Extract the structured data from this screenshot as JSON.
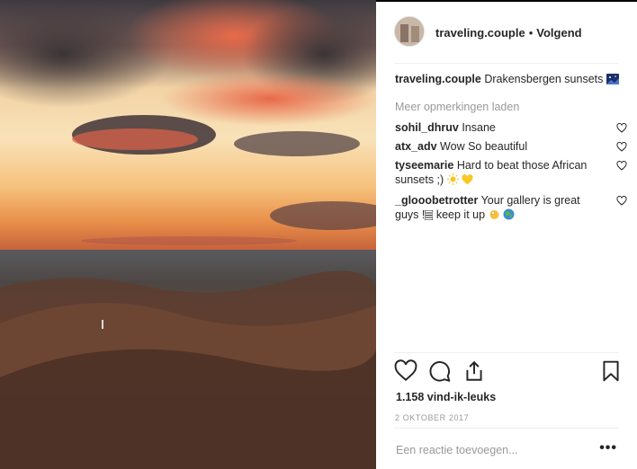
{
  "post": {
    "username": "traveling.couple",
    "follow_state": "Volgend",
    "caption_user": "traveling.couple",
    "caption_text": "Drakensbergen sunsets",
    "caption_emoji": "night-sky-emoji"
  },
  "comments_ui": {
    "load_more": "Meer opmerkingen laden"
  },
  "comments": [
    {
      "user": "sohil_dhruv",
      "text": "Insane"
    },
    {
      "user": "atx_adv",
      "text": "Wow So beautiful"
    },
    {
      "user": "tyseemarie",
      "text": "Hard to beat those African sunsets ;)",
      "emojis": [
        "sun-emoji",
        "yellow-heart-emoji"
      ]
    },
    {
      "user": "_glooobetrotter",
      "text": "Your gallery is great guys !",
      "text2": "keep it up",
      "emojis": [
        "ok-hand-emoji",
        "globe-emoji"
      ]
    }
  ],
  "stats": {
    "likes": "1.158 vind-ik-leuks",
    "date": "2 OKTOBER 2017"
  },
  "composer": {
    "placeholder": "Een reactie toevoegen...",
    "more_label": "•••"
  },
  "icons": {
    "like": "heart-icon",
    "comment": "comment-icon",
    "share": "share-icon",
    "save": "bookmark-icon",
    "comment_like": "heart-icon"
  },
  "colors": {
    "text": "#262626",
    "muted": "#999999",
    "divider": "#efefef"
  }
}
